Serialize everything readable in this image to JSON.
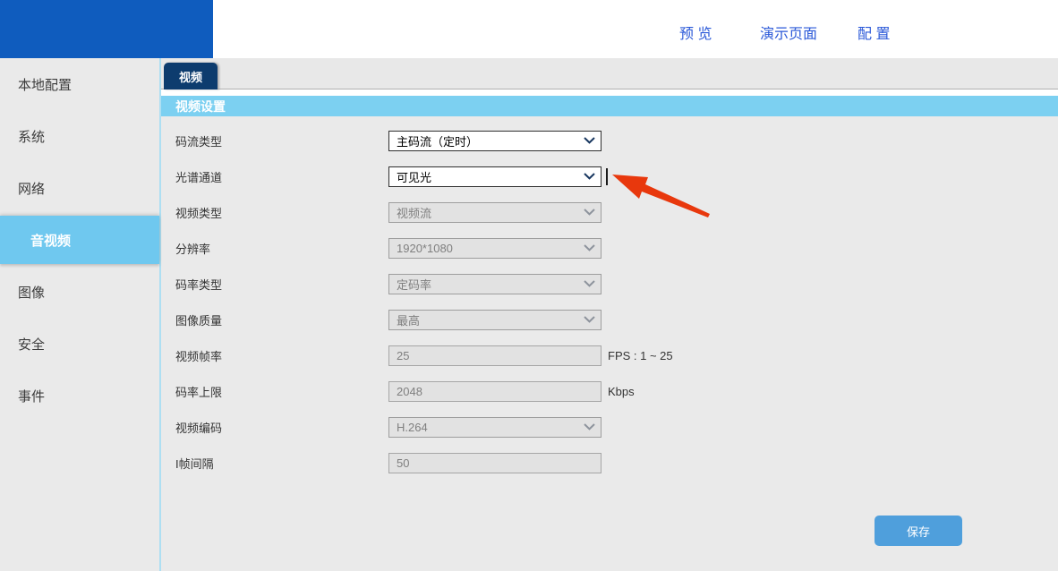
{
  "header": {
    "nav": {
      "preview": "预 览",
      "demo": "演示页面",
      "config": "配 置"
    }
  },
  "sidebar": {
    "items": [
      {
        "label": "本地配置",
        "selected": false
      },
      {
        "label": "系统",
        "selected": false
      },
      {
        "label": "网络",
        "selected": false
      },
      {
        "label": "音视频",
        "selected": true
      },
      {
        "label": "图像",
        "selected": false
      },
      {
        "label": "安全",
        "selected": false
      },
      {
        "label": "事件",
        "selected": false
      }
    ]
  },
  "main": {
    "tab": "视频",
    "section_title": "视频设置",
    "rows": [
      {
        "label": "码流类型",
        "value": "主码流（定时）",
        "type": "select",
        "enabled": true,
        "suffix": ""
      },
      {
        "label": "光谱通道",
        "value": "可见光",
        "type": "select",
        "enabled": true,
        "suffix": ""
      },
      {
        "label": "视频类型",
        "value": "视频流",
        "type": "select",
        "enabled": false,
        "suffix": ""
      },
      {
        "label": "分辨率",
        "value": "1920*1080",
        "type": "select",
        "enabled": false,
        "suffix": ""
      },
      {
        "label": "码率类型",
        "value": "定码率",
        "type": "select",
        "enabled": false,
        "suffix": ""
      },
      {
        "label": "图像质量",
        "value": "最高",
        "type": "select",
        "enabled": false,
        "suffix": ""
      },
      {
        "label": "视频帧率",
        "value": "25",
        "type": "input",
        "enabled": false,
        "suffix": "FPS : 1 ~ 25"
      },
      {
        "label": "码率上限",
        "value": "2048",
        "type": "input",
        "enabled": false,
        "suffix": "Kbps"
      },
      {
        "label": "视频编码",
        "value": "H.264",
        "type": "select",
        "enabled": false,
        "suffix": ""
      },
      {
        "label": "I帧间隔",
        "value": "50",
        "type": "input",
        "enabled": false,
        "suffix": ""
      }
    ],
    "save_label": "保存"
  },
  "colors": {
    "banner_blue": "#0f5cbe",
    "nav_link_blue": "#2b59d8",
    "tab_navy": "#0d3c6e",
    "section_bar_blue": "#7cd0f1",
    "sidebar_selected_blue": "#6fc8ef",
    "save_button_blue": "#4f9fdc",
    "annotation_arrow_red": "#e8380d"
  }
}
